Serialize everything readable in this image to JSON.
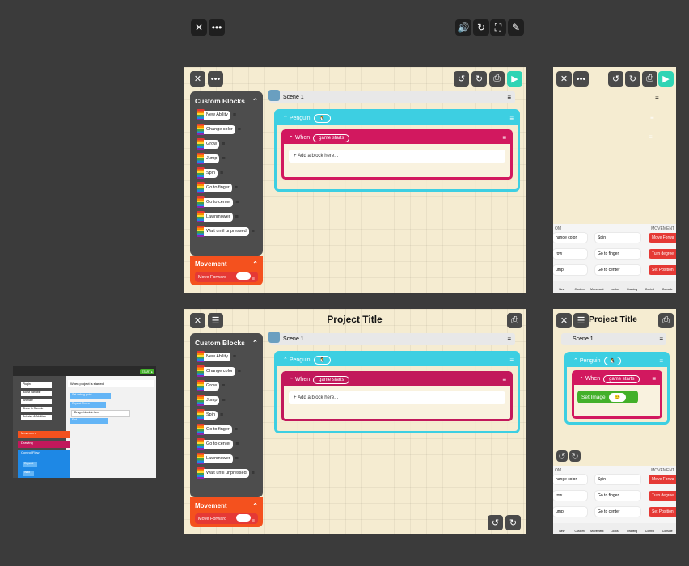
{
  "top_toolbar": {
    "close": "✕",
    "more": "•••",
    "sound": "🔊",
    "redo": "↻",
    "fullscreen": "⛶",
    "pen": "✎"
  },
  "panel1": {
    "palette_title": "Custom Blocks",
    "blocks": [
      "New Ability",
      "Change color",
      "Grow",
      "Jump",
      "Spin",
      "Go to finger",
      "Go to center",
      "Lawnmower",
      "Wait until unpressed"
    ],
    "movement_title": "Movement",
    "movement_block": "Move Forward",
    "scene": "Scene 1",
    "sprite": "Penguin",
    "when": "When",
    "event": "game starts",
    "add": "Add a block here..."
  },
  "panel2": {
    "title": "Project Title",
    "palette_title": "Custom Blocks",
    "blocks": [
      "New Ability",
      "Change color",
      "Grow",
      "Jump",
      "Spin",
      "Go to finger",
      "Go to center",
      "Lawnmower",
      "Wait until unpressed"
    ],
    "movement_title": "Movement",
    "movement_block": "Move Forward",
    "scene": "Scene 1",
    "sprite": "Penguin",
    "when": "When",
    "event": "game starts",
    "add": "Add a block here..."
  },
  "narrow1": {
    "left_label": "OM",
    "right_label": "MOVEMENT",
    "col1": [
      "hange color",
      "row",
      "ump"
    ],
    "col2": [
      "Spin",
      "Go to finger",
      "Go to center"
    ],
    "col3": [
      "Move Forwa",
      "Turn degree",
      "Set Position"
    ],
    "tabs": [
      "New",
      "Custom",
      "Movement",
      "Looks",
      "Drawing",
      "Control",
      "Console"
    ]
  },
  "narrow2": {
    "title": "Project Title",
    "scene": "Scene 1",
    "sprite": "Penguin",
    "when": "When",
    "event": "game starts",
    "set_image": "Set Image",
    "left_label": "OM",
    "right_label": "MOVEMENT",
    "col1": [
      "hange color",
      "row",
      "ump"
    ],
    "col2": [
      "Spin",
      "Go to finger",
      "Go to center"
    ],
    "col3": [
      "Move Forwa",
      "Turn degree",
      "Set Position"
    ],
    "tabs": [
      "New",
      "Custom",
      "Movement",
      "Looks",
      "Drawing",
      "Control",
      "Console"
    ]
  },
  "mini": {
    "start": "START ▸",
    "when": "When project is started",
    "items": [
      "Plugin",
      "Boost Variable",
      "Animate",
      "Show In Sample",
      "Set size & Abilities"
    ],
    "cats": [
      "Movement",
      "Drawing",
      "Control Flow"
    ],
    "sub": [
      "Repeat",
      "Wait"
    ],
    "blocks": [
      "Set debug point",
      "Repeat Times",
      "Drag a block in here",
      "End"
    ]
  }
}
